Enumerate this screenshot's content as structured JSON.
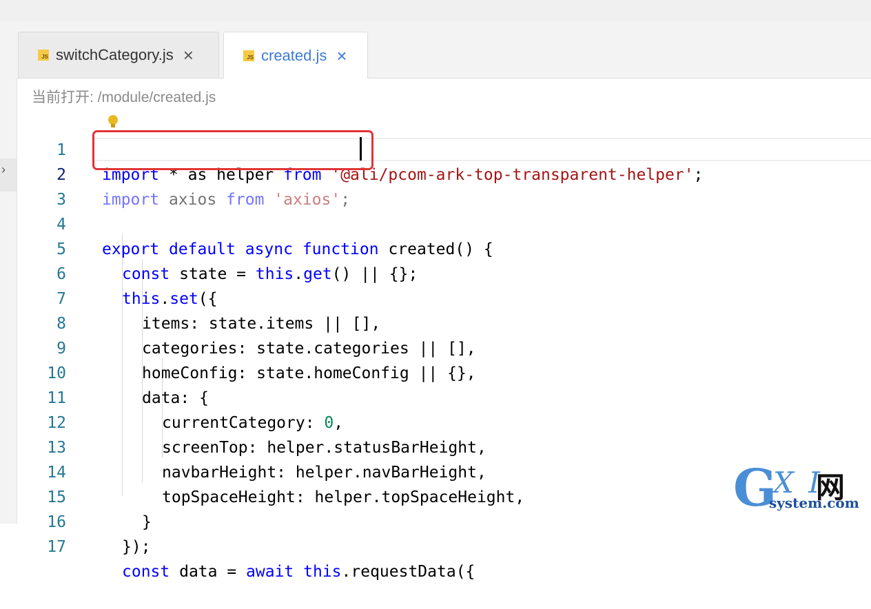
{
  "tabs": [
    {
      "label": "switchCategory.js",
      "active": false,
      "icon": "js-file-icon"
    },
    {
      "label": "created.js",
      "active": true,
      "icon": "js-file-icon"
    }
  ],
  "breadcrumb": "当前打开: /module/created.js",
  "colors": {
    "accent": "#3d7ad6",
    "highlight_box": "#e03434",
    "keyword": "#0000ff",
    "string": "#a31515",
    "number": "#098658"
  },
  "editor": {
    "active_line": 2,
    "lines": [
      {
        "n": "1",
        "parts": [
          [
            "kw",
            "import"
          ],
          [
            "",
            "&#32;* as helper "
          ],
          [
            "kw",
            "from"
          ],
          [
            "",
            ""
          ],
          [
            "str",
            " '@ali/pcom-ark-top-transparent-helper'"
          ],
          [
            "",
            ";"
          ]
        ]
      },
      {
        "n": "2"
      },
      {
        "n": "3"
      },
      {
        "n": "4"
      },
      {
        "n": "5"
      },
      {
        "n": "6"
      },
      {
        "n": "7"
      },
      {
        "n": "8"
      },
      {
        "n": "9"
      },
      {
        "n": "10"
      },
      {
        "n": "11"
      },
      {
        "n": "12"
      },
      {
        "n": "13"
      },
      {
        "n": "14"
      },
      {
        "n": "15"
      },
      {
        "n": "16"
      },
      {
        "n": "17"
      }
    ],
    "code": {
      "l1": {
        "kw1": "import",
        "t1": " * as helper ",
        "kw2": "from",
        "s1": " '@ali/pcom-ark-top-transparent-helper'",
        "t2": ";"
      },
      "l2": {
        "kw1": "import",
        "t1": " axios ",
        "kw2": "from",
        "s1": " 'axios'",
        "t2": ";"
      },
      "l4": {
        "kw1": "export",
        "kw2": " default",
        "kw3": " async",
        "kw4": " function",
        "t1": " created() {"
      },
      "l5": {
        "kw1": "const",
        "t1": " state = ",
        "kw2": "this",
        "t2": ".",
        "kw3": "get",
        "t3": "() || {};"
      },
      "l6": {
        "kw1": "this",
        "t1": ".",
        "kw2": "set",
        "t2": "({"
      },
      "l7": {
        "t1": "items: state.items || [],"
      },
      "l8": {
        "t1": "categories: state.categories || [],"
      },
      "l9": {
        "t1": "homeConfig: state.homeConfig || {},"
      },
      "l10": {
        "t1": "data: {"
      },
      "l11": {
        "t1": "currentCategory: ",
        "n1": "0",
        "t2": ","
      },
      "l12": {
        "t1": "screenTop: helper.statusBarHeight,"
      },
      "l13": {
        "t1": "navbarHeight: helper.navBarHeight,"
      },
      "l14": {
        "t1": "topSpaceHeight: helper.topSpaceHeight,"
      },
      "l15": {
        "t1": "}"
      },
      "l16": {
        "t1": "});"
      },
      "l17": {
        "kw1": "const",
        "t1": " data = ",
        "kw2": "await",
        "kw3": " this",
        "t2": ".requestData({"
      }
    }
  },
  "watermark": {
    "g": "G",
    "xi": "X I",
    "net": "网",
    "system": "system.com",
    "small": "网"
  }
}
